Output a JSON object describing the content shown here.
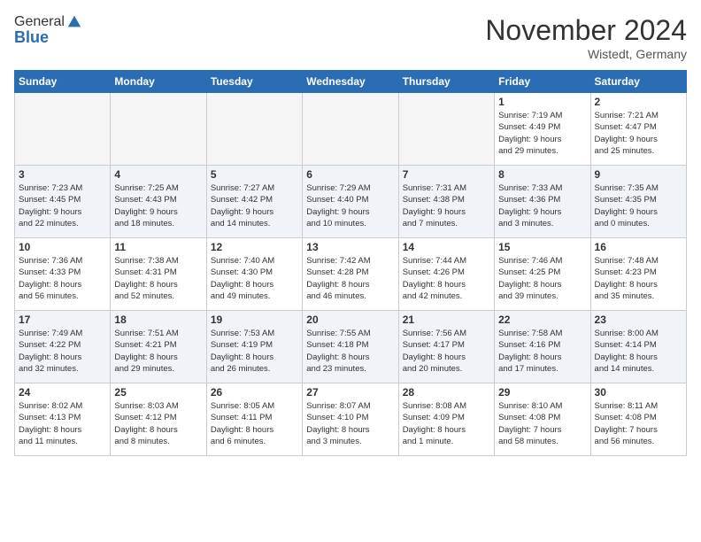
{
  "header": {
    "logo_general": "General",
    "logo_blue": "Blue",
    "month_title": "November 2024",
    "location": "Wistedt, Germany"
  },
  "days_of_week": [
    "Sunday",
    "Monday",
    "Tuesday",
    "Wednesday",
    "Thursday",
    "Friday",
    "Saturday"
  ],
  "weeks": [
    [
      {
        "day": "",
        "info": ""
      },
      {
        "day": "",
        "info": ""
      },
      {
        "day": "",
        "info": ""
      },
      {
        "day": "",
        "info": ""
      },
      {
        "day": "",
        "info": ""
      },
      {
        "day": "1",
        "info": "Sunrise: 7:19 AM\nSunset: 4:49 PM\nDaylight: 9 hours\nand 29 minutes."
      },
      {
        "day": "2",
        "info": "Sunrise: 7:21 AM\nSunset: 4:47 PM\nDaylight: 9 hours\nand 25 minutes."
      }
    ],
    [
      {
        "day": "3",
        "info": "Sunrise: 7:23 AM\nSunset: 4:45 PM\nDaylight: 9 hours\nand 22 minutes."
      },
      {
        "day": "4",
        "info": "Sunrise: 7:25 AM\nSunset: 4:43 PM\nDaylight: 9 hours\nand 18 minutes."
      },
      {
        "day": "5",
        "info": "Sunrise: 7:27 AM\nSunset: 4:42 PM\nDaylight: 9 hours\nand 14 minutes."
      },
      {
        "day": "6",
        "info": "Sunrise: 7:29 AM\nSunset: 4:40 PM\nDaylight: 9 hours\nand 10 minutes."
      },
      {
        "day": "7",
        "info": "Sunrise: 7:31 AM\nSunset: 4:38 PM\nDaylight: 9 hours\nand 7 minutes."
      },
      {
        "day": "8",
        "info": "Sunrise: 7:33 AM\nSunset: 4:36 PM\nDaylight: 9 hours\nand 3 minutes."
      },
      {
        "day": "9",
        "info": "Sunrise: 7:35 AM\nSunset: 4:35 PM\nDaylight: 9 hours\nand 0 minutes."
      }
    ],
    [
      {
        "day": "10",
        "info": "Sunrise: 7:36 AM\nSunset: 4:33 PM\nDaylight: 8 hours\nand 56 minutes."
      },
      {
        "day": "11",
        "info": "Sunrise: 7:38 AM\nSunset: 4:31 PM\nDaylight: 8 hours\nand 52 minutes."
      },
      {
        "day": "12",
        "info": "Sunrise: 7:40 AM\nSunset: 4:30 PM\nDaylight: 8 hours\nand 49 minutes."
      },
      {
        "day": "13",
        "info": "Sunrise: 7:42 AM\nSunset: 4:28 PM\nDaylight: 8 hours\nand 46 minutes."
      },
      {
        "day": "14",
        "info": "Sunrise: 7:44 AM\nSunset: 4:26 PM\nDaylight: 8 hours\nand 42 minutes."
      },
      {
        "day": "15",
        "info": "Sunrise: 7:46 AM\nSunset: 4:25 PM\nDaylight: 8 hours\nand 39 minutes."
      },
      {
        "day": "16",
        "info": "Sunrise: 7:48 AM\nSunset: 4:23 PM\nDaylight: 8 hours\nand 35 minutes."
      }
    ],
    [
      {
        "day": "17",
        "info": "Sunrise: 7:49 AM\nSunset: 4:22 PM\nDaylight: 8 hours\nand 32 minutes."
      },
      {
        "day": "18",
        "info": "Sunrise: 7:51 AM\nSunset: 4:21 PM\nDaylight: 8 hours\nand 29 minutes."
      },
      {
        "day": "19",
        "info": "Sunrise: 7:53 AM\nSunset: 4:19 PM\nDaylight: 8 hours\nand 26 minutes."
      },
      {
        "day": "20",
        "info": "Sunrise: 7:55 AM\nSunset: 4:18 PM\nDaylight: 8 hours\nand 23 minutes."
      },
      {
        "day": "21",
        "info": "Sunrise: 7:56 AM\nSunset: 4:17 PM\nDaylight: 8 hours\nand 20 minutes."
      },
      {
        "day": "22",
        "info": "Sunrise: 7:58 AM\nSunset: 4:16 PM\nDaylight: 8 hours\nand 17 minutes."
      },
      {
        "day": "23",
        "info": "Sunrise: 8:00 AM\nSunset: 4:14 PM\nDaylight: 8 hours\nand 14 minutes."
      }
    ],
    [
      {
        "day": "24",
        "info": "Sunrise: 8:02 AM\nSunset: 4:13 PM\nDaylight: 8 hours\nand 11 minutes."
      },
      {
        "day": "25",
        "info": "Sunrise: 8:03 AM\nSunset: 4:12 PM\nDaylight: 8 hours\nand 8 minutes."
      },
      {
        "day": "26",
        "info": "Sunrise: 8:05 AM\nSunset: 4:11 PM\nDaylight: 8 hours\nand 6 minutes."
      },
      {
        "day": "27",
        "info": "Sunrise: 8:07 AM\nSunset: 4:10 PM\nDaylight: 8 hours\nand 3 minutes."
      },
      {
        "day": "28",
        "info": "Sunrise: 8:08 AM\nSunset: 4:09 PM\nDaylight: 8 hours\nand 1 minute."
      },
      {
        "day": "29",
        "info": "Sunrise: 8:10 AM\nSunset: 4:08 PM\nDaylight: 7 hours\nand 58 minutes."
      },
      {
        "day": "30",
        "info": "Sunrise: 8:11 AM\nSunset: 4:08 PM\nDaylight: 7 hours\nand 56 minutes."
      }
    ]
  ]
}
